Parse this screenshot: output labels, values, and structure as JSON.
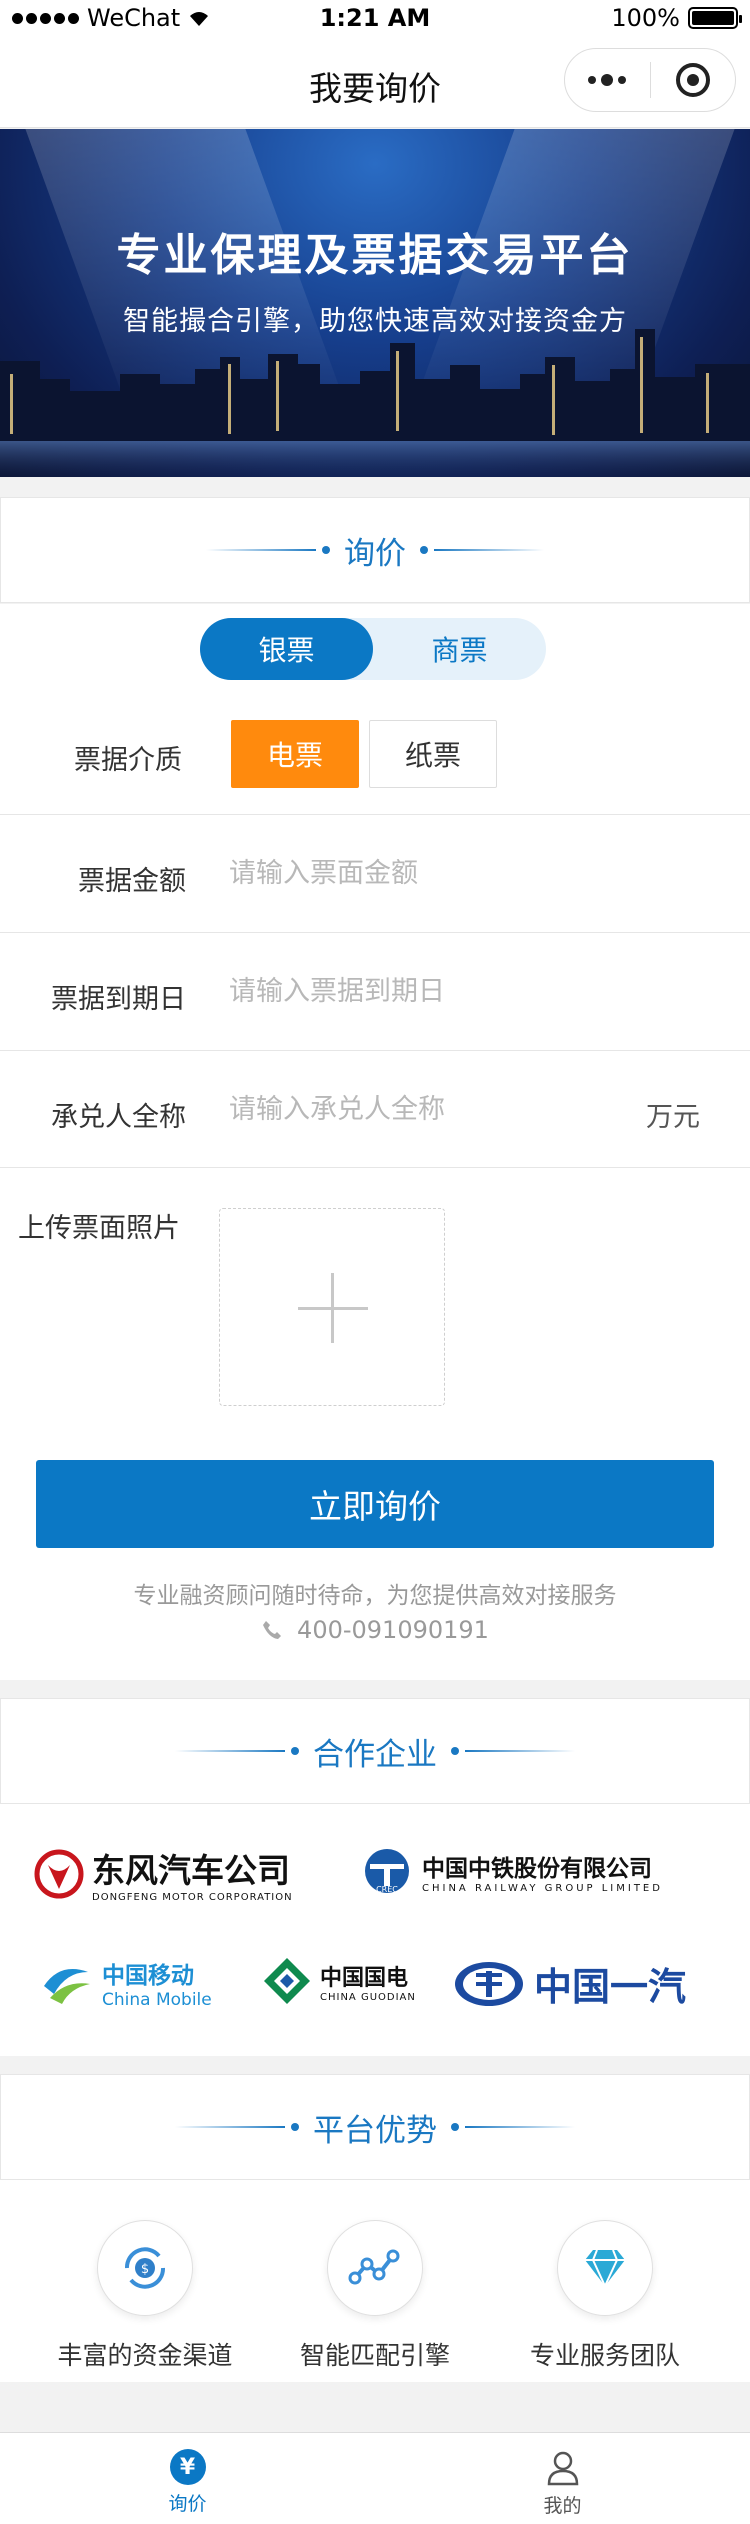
{
  "status_bar": {
    "carrier": "WeChat",
    "time": "1:21 AM",
    "battery": "100%",
    "battery_level": 1.0
  },
  "nav": {
    "title": "我要询价"
  },
  "banner": {
    "headline": "专业保理及票据交易平台",
    "subline": "智能撮合引擎，助您快速高效对接资金方"
  },
  "inquiry": {
    "section_title": "询价",
    "bill_type": {
      "options": [
        "银票",
        "商票"
      ],
      "selected": "银票"
    },
    "medium": {
      "label": "票据介质",
      "options": [
        "电票",
        "纸票"
      ],
      "selected": "电票"
    },
    "fields": [
      {
        "label": "票据金额",
        "placeholder": "请输入票面金额",
        "unit": ""
      },
      {
        "label": "票据到期日",
        "placeholder": "请输入票据到期日",
        "unit": ""
      },
      {
        "label": "承兑人全称",
        "placeholder": "请输入承兑人全称",
        "unit": "万元"
      }
    ],
    "upload_label": "上传票面照片",
    "submit_label": "立即询价",
    "hint": "专业融资顾问随时待命，为您提供高效对接服务",
    "phone": "400-091090191"
  },
  "partners": {
    "section_title": "合作企业",
    "logos": [
      {
        "name": "东风汽车公司",
        "sub": "DONGFENG MOTOR CORPORATION",
        "color": "#c8161d"
      },
      {
        "name": "中国中铁股份有限公司",
        "sub": "CHINA RAILWAY GROUP LIMITED",
        "color": "#1a5aa8"
      },
      {
        "name": "中国移动",
        "sub": "China Mobile",
        "color": "#1d8fd4"
      },
      {
        "name": "中国国电",
        "sub": "CHINA GUODIAN",
        "color": "#0f8a4e"
      },
      {
        "name": "中国一汽",
        "sub": "",
        "color": "#1c4aa0"
      }
    ]
  },
  "advantages": {
    "section_title": "平台优势",
    "items": [
      {
        "label": "丰富的资金渠道",
        "icon": "money-cycle-icon"
      },
      {
        "label": "智能匹配引擎",
        "icon": "network-nodes-icon"
      },
      {
        "label": "专业服务团队",
        "icon": "diamond-icon"
      }
    ]
  },
  "tabbar": {
    "items": [
      {
        "label": "询价",
        "icon": "yen-icon",
        "active": true
      },
      {
        "label": "我的",
        "icon": "user-icon",
        "active": false
      }
    ]
  },
  "colors": {
    "primary": "#0b78c5",
    "accent": "#ff8a0d",
    "section_title": "#1a78c2"
  }
}
